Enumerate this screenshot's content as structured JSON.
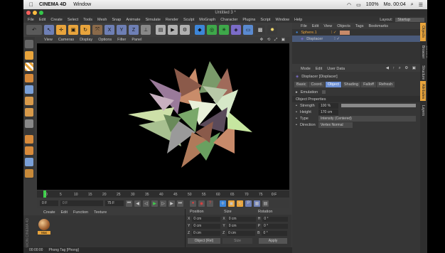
{
  "os": {
    "app_name": "CINEMA 4D",
    "menu_window": "Window",
    "time": "Mo. 00:04",
    "battery_pct": "100%"
  },
  "window": {
    "title": "Untitled 3 *"
  },
  "menubar": {
    "items": [
      "File",
      "Edit",
      "Create",
      "Select",
      "Tools",
      "Mesh",
      "Snap",
      "Animate",
      "Simulate",
      "Render",
      "Sculpt",
      "MoGraph",
      "Character",
      "Plugins",
      "Script",
      "Window",
      "Help"
    ],
    "layout_label": "Layout:",
    "layout_value": "Startup"
  },
  "viewport": {
    "menu": [
      "View",
      "Cameras",
      "Display",
      "Options",
      "Filter",
      "Panel"
    ]
  },
  "timeline": {
    "ticks": [
      "0",
      "5",
      "10",
      "15",
      "20",
      "25",
      "30",
      "35",
      "40",
      "45",
      "50",
      "55",
      "60",
      "65",
      "70",
      "75"
    ],
    "current_frame": "0 F",
    "start_field": "0 F",
    "min_field": "0 F",
    "max_field": "75 F",
    "end_field": "75 F"
  },
  "materials": {
    "menu": [
      "Create",
      "Edit",
      "Function",
      "Texture"
    ],
    "swatch_label": "Mat"
  },
  "coordinates": {
    "headers": [
      "Position",
      "Size",
      "Rotation"
    ],
    "rows": [
      {
        "axis": "X",
        "pos": "0 cm",
        "size_axis": "X",
        "size": "0 cm",
        "rot_axis": "H",
        "rot": "0 °"
      },
      {
        "axis": "Y",
        "pos": "0 cm",
        "size_axis": "Y",
        "size": "0 cm",
        "rot_axis": "P",
        "rot": "0 °"
      },
      {
        "axis": "Z",
        "pos": "0 cm",
        "size_axis": "Z",
        "size": "0 cm",
        "rot_axis": "B",
        "rot": "0 °"
      }
    ],
    "mode_select": "Object (Rel)",
    "size_select": "Size",
    "apply_label": "Apply"
  },
  "status": {
    "time": "00:00:00",
    "message": "Phong Tag [Phong]"
  },
  "objects": {
    "menu": [
      "File",
      "Edit",
      "View",
      "Objects",
      "Tags",
      "Bookmarks"
    ],
    "items": [
      "Sphere.1",
      "Displacer"
    ]
  },
  "attributes": {
    "menu": [
      "Mode",
      "Edit",
      "User Data"
    ],
    "object_title": "Displacer [Displacer]",
    "tabs": [
      "Basic",
      "Coord.",
      "Object",
      "Shading",
      "Falloff",
      "Refresh"
    ],
    "active_tab": "Object",
    "emulation_label": "Emulation",
    "section_title": "Object Properties",
    "strength_label": "Strength",
    "strength_value": "100 %",
    "strength_fraction": 1.0,
    "height_label": "Height",
    "height_value": "170 cm",
    "type_label": "Type",
    "type_value": "Intensity (Centered)",
    "direction_label": "Direction",
    "direction_value": "Vertex Normal"
  },
  "side_tabs": [
    "Objects",
    "Content Browser",
    "Structure",
    "Attributes",
    "Layers"
  ],
  "brand_vertical": "MAXON CINEMA 4D",
  "colors": {
    "accent": "#6b8fd4",
    "timeline_marker": "#3ecf4a"
  }
}
